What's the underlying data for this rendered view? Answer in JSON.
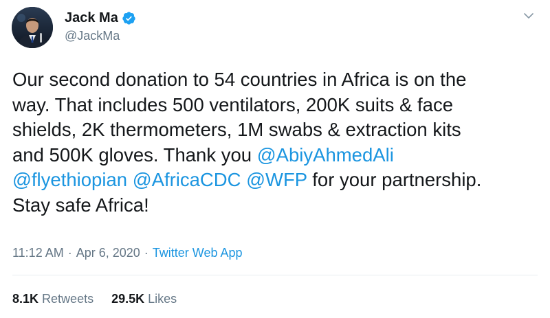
{
  "author": {
    "name": "Jack Ma",
    "handle": "@JackMa"
  },
  "icons": {
    "verified": "verified-badge-icon",
    "menu": "chevron-down-icon"
  },
  "tweet": {
    "lines": [
      [
        {
          "text": "Our second donation to 54 countries in Africa is on the",
          "mention": false
        }
      ],
      [
        {
          "text": "way. That includes 500 ventilators, 200K suits & face",
          "mention": false
        }
      ],
      [
        {
          "text": "shields, 2K thermometers, 1M swabs & extraction kits",
          "mention": false
        }
      ],
      [
        {
          "text": "and 500K gloves. Thank you ",
          "mention": false
        },
        {
          "text": "@AbiyAhmedAli",
          "mention": true
        }
      ],
      [
        {
          "text": "@flyethiopian",
          "mention": true
        },
        {
          "text": " ",
          "mention": false
        },
        {
          "text": "@AfricaCDC",
          "mention": true
        },
        {
          "text": " ",
          "mention": false
        },
        {
          "text": "@WFP",
          "mention": true
        },
        {
          "text": " for your partnership.",
          "mention": false
        }
      ],
      [
        {
          "text": "Stay safe Africa!",
          "mention": false
        }
      ]
    ]
  },
  "meta": {
    "time": "11:12 AM",
    "separator": "·",
    "date": "Apr 6, 2020",
    "source": "Twitter Web App"
  },
  "stats": {
    "retweets_count": "8.1K",
    "retweets_label": "Retweets",
    "likes_count": "29.5K",
    "likes_label": "Likes"
  },
  "colors": {
    "link": "#1b95e0",
    "text": "#14171a",
    "muted": "#657786",
    "divider": "#e6ecf0"
  }
}
